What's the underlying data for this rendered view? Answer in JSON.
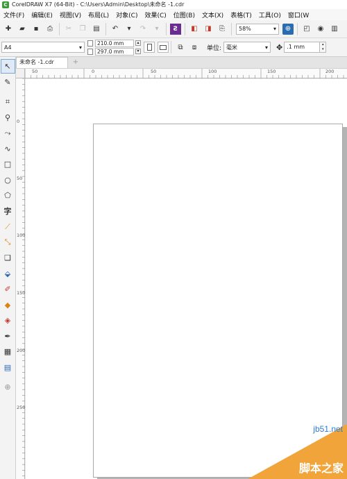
{
  "window": {
    "title": "CorelDRAW X7 (64-Bit) - C:\\Users\\Admin\\Desktop\\未命名 -1.cdr",
    "logo_glyph": "C"
  },
  "menu": [
    {
      "label": "文件(F)"
    },
    {
      "label": "编辑(E)"
    },
    {
      "label": "视图(V)"
    },
    {
      "label": "布局(L)"
    },
    {
      "label": "对象(C)"
    },
    {
      "label": "效果(C)"
    },
    {
      "label": "位图(B)"
    },
    {
      "label": "文本(X)"
    },
    {
      "label": "表格(T)"
    },
    {
      "label": "工具(O)"
    },
    {
      "label": "窗口(W"
    }
  ],
  "toolbar": {
    "zoom_value": "58%",
    "icons": [
      "new-icon",
      "open-icon",
      "save-icon",
      "print-icon",
      "cut-icon",
      "copy-icon",
      "paste-icon",
      "undo-icon",
      "redo-icon",
      "launcher-icon",
      "import-icon",
      "export-icon",
      "publish-pdf-icon",
      "zoom-icon"
    ]
  },
  "property_bar": {
    "page_size": "A4",
    "width": "210.0 mm",
    "height": "297.0 mm",
    "units_label": "单位:",
    "units_value": "毫米",
    "nudge_value": ".1 mm"
  },
  "document_tab": {
    "label": "未命名 -1.cdr",
    "add_glyph": "+"
  },
  "rulers": {
    "horizontal_labels": [
      "50",
      "0",
      "50",
      "100",
      "150",
      "200"
    ],
    "vertical_labels": [
      "0",
      "50",
      "100",
      "150",
      "200",
      "250",
      "300",
      "350"
    ]
  },
  "watermark": {
    "url": "jb51.net",
    "text": "脚本之家"
  },
  "colors": {
    "accent": "#2b6cb0",
    "watermark_orange": "#f0a43a",
    "logo_green": "#3e9a3a"
  }
}
